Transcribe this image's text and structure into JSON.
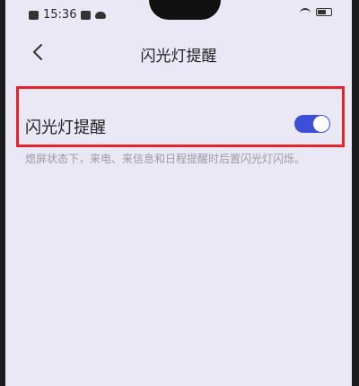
{
  "status_bar": {
    "time": "15:36"
  },
  "nav": {
    "title": "闪光灯提醒"
  },
  "setting": {
    "label": "闪光灯提醒",
    "enabled": true,
    "description": "熄屏状态下，来电、来信息和日程提醒时后置闪光灯闪烁。"
  },
  "colors": {
    "background": "#e9e8f4",
    "toggle_on": "#3c4fd6",
    "highlight": "#e8222a",
    "description_text": "#9a9aa8"
  },
  "icons": {
    "back": "chevron-left-icon",
    "wifi": "wifi-icon",
    "battery": "battery-icon"
  }
}
